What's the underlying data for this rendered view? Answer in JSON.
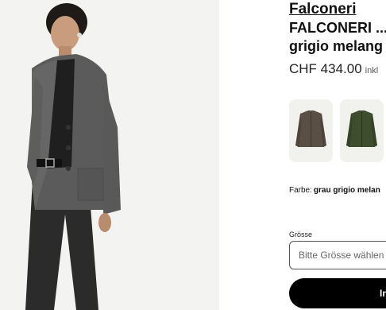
{
  "product": {
    "brand": "Falconeri",
    "title_line1": "FALCONERI ...",
    "title_line2": "grigio melang",
    "price": "CHF 434.00",
    "tax_note": "inkl"
  },
  "colors": {
    "label": "Farbe:",
    "selected": "grau grigio melan",
    "swatches": [
      "brown-jacket",
      "green-jacket"
    ]
  },
  "size": {
    "label": "Grösse",
    "placeholder": "Bitte Grösse wählen"
  },
  "cart": {
    "label": "In"
  }
}
